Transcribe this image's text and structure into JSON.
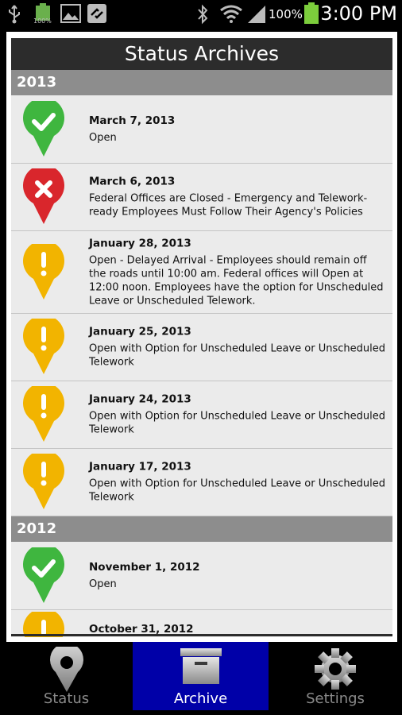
{
  "status_bar": {
    "time": "3:00 PM",
    "battery_percent": "100%",
    "battery_small": "100%",
    "icons": [
      "usb-icon",
      "battery-full-icon",
      "gallery-icon",
      "sync-icon",
      "bluetooth-icon",
      "wifi-icon",
      "signal-icon",
      "battery-icon"
    ]
  },
  "header": {
    "title": "Status Archives"
  },
  "colors": {
    "green": "#3fb63f",
    "red": "#d9262c",
    "yellow": "#f2b400",
    "tab_active": "#0000a8"
  },
  "archive": {
    "years": [
      {
        "year": "2013",
        "items": [
          {
            "date": "March 7, 2013",
            "status": "Open",
            "icon": "open-pin-icon"
          },
          {
            "date": "March 6, 2013",
            "status": "Federal Offices are Closed - Emergency and Telework-ready Employees Must Follow Their Agency's Policies",
            "icon": "closed-pin-icon"
          },
          {
            "date": "January 28, 2013",
            "status": "Open - Delayed Arrival - Employees should remain off the roads until 10:00 am. Federal offices will Open at 12:00 noon. Employees have the option for Unscheduled Leave or Unscheduled Telework.",
            "icon": "alert-pin-icon"
          },
          {
            "date": "January 25, 2013",
            "status": "Open with Option for Unscheduled Leave or Unscheduled Telework",
            "icon": "alert-pin-icon"
          },
          {
            "date": "January 24, 2013",
            "status": "Open with Option for Unscheduled Leave or Unscheduled Telework",
            "icon": "alert-pin-icon"
          },
          {
            "date": "January 17, 2013",
            "status": "Open with Option for Unscheduled Leave or Unscheduled Telework",
            "icon": "alert-pin-icon"
          }
        ]
      },
      {
        "year": "2012",
        "items": [
          {
            "date": "November 1, 2012",
            "status": "Open",
            "icon": "open-pin-icon"
          },
          {
            "date": "October 31, 2012",
            "status": "",
            "icon": "alert-pin-icon"
          }
        ]
      }
    ]
  },
  "tabs": [
    {
      "label": "Status",
      "icon": "map-pin-icon",
      "active": false
    },
    {
      "label": "Archive",
      "icon": "archive-box-icon",
      "active": true
    },
    {
      "label": "Settings",
      "icon": "gear-icon",
      "active": false
    }
  ]
}
